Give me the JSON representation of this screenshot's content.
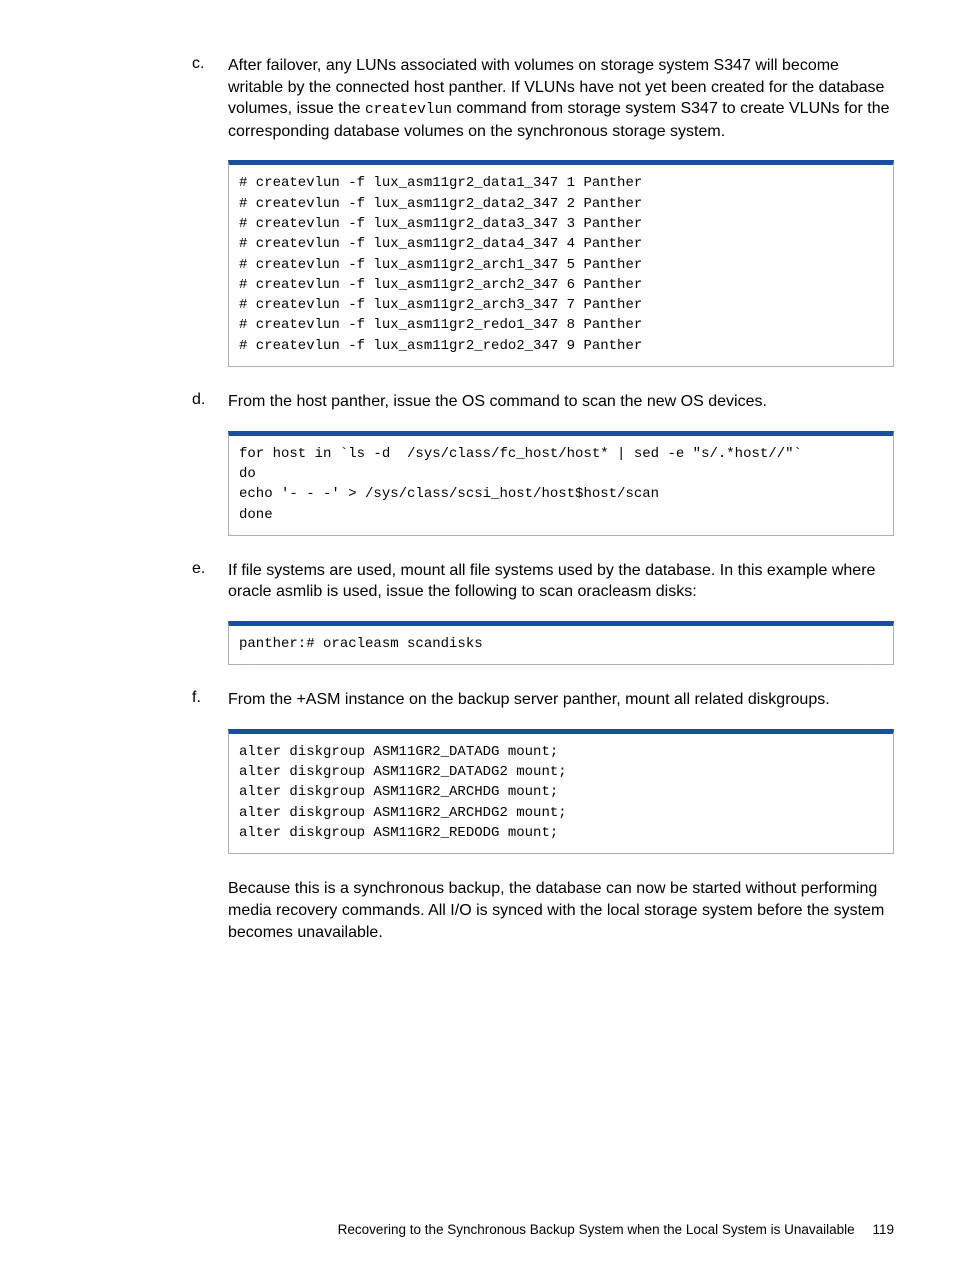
{
  "steps": [
    {
      "marker": "c.",
      "text_before": "After failover, any LUNs associated with volumes on storage system S347 will become writable by the connected host panther. If VLUNs have not yet been created for the database volumes, issue the ",
      "inline_code": "createvlun",
      "text_after": " command from storage system S347 to create VLUNs for the corresponding database volumes on the synchronous storage system.",
      "code": "# createvlun -f lux_asm11gr2_data1_347 1 Panther\n# createvlun -f lux_asm11gr2_data2_347 2 Panther\n# createvlun -f lux_asm11gr2_data3_347 3 Panther\n# createvlun -f lux_asm11gr2_data4_347 4 Panther\n# createvlun -f lux_asm11gr2_arch1_347 5 Panther\n# createvlun -f lux_asm11gr2_arch2_347 6 Panther\n# createvlun -f lux_asm11gr2_arch3_347 7 Panther\n# createvlun -f lux_asm11gr2_redo1_347 8 Panther\n# createvlun -f lux_asm11gr2_redo2_347 9 Panther"
    },
    {
      "marker": "d.",
      "text_before": "From the host panther, issue the OS command to scan the new OS devices.",
      "inline_code": "",
      "text_after": "",
      "code": "for host in `ls -d  /sys/class/fc_host/host* | sed -e \"s/.*host//\"`\ndo\necho '- - -' > /sys/class/scsi_host/host$host/scan\ndone"
    },
    {
      "marker": "e.",
      "text_before": "If file systems are used, mount all file systems used by the database. In this example where oracle asmlib is used, issue the following to scan oracleasm disks:",
      "inline_code": "",
      "text_after": "",
      "code": "panther:# oracleasm scandisks"
    },
    {
      "marker": "f.",
      "text_before": "From the +ASM instance on the backup server panther, mount all related diskgroups.",
      "inline_code": "",
      "text_after": "",
      "code": "alter diskgroup ASM11GR2_DATADG mount;\nalter diskgroup ASM11GR2_DATADG2 mount;\nalter diskgroup ASM11GR2_ARCHDG mount;\nalter diskgroup ASM11GR2_ARCHDG2 mount;\nalter diskgroup ASM11GR2_REDODG mount;",
      "trailing_text": "Because this is a synchronous backup, the database can now be started without performing media recovery commands. All I/O is synced with the local storage system before the system becomes unavailable."
    }
  ],
  "footer": {
    "title": "Recovering to the Synchronous Backup System when the Local System is Unavailable",
    "page": "119"
  }
}
